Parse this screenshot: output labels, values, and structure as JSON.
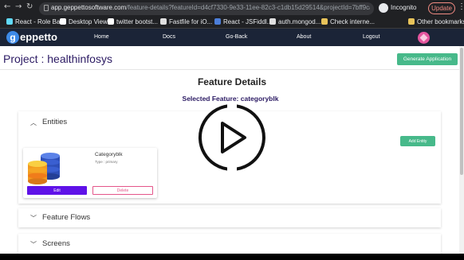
{
  "browser": {
    "url_host": "app.geppettosoftware.com",
    "url_path": "/feature-details?featureId=d4cf7330-9e33-11ee-82c3-c1db15d29514&projectId=7bff9ca0-9a4e-11ee-a...",
    "incognito_label": "Incognito",
    "update_label": "Update",
    "bookmarks": [
      {
        "label": "React - Role Ba...",
        "icon_color": "#61dafb"
      },
      {
        "label": "Desktop View",
        "icon_color": "#ffffff"
      },
      {
        "label": "twitter bootst...",
        "icon_color": "#ffffff"
      },
      {
        "label": "Fastfile for iO...",
        "icon_color": "#e0e0e0"
      },
      {
        "label": "React - JSFiddl...",
        "icon_color": "#4c7ed9"
      },
      {
        "label": "auth.mongod...",
        "icon_color": "#e0e0e0"
      },
      {
        "label": "Check interne...",
        "icon_color": "#e8c35a"
      }
    ],
    "other_bookmarks": "Other bookmarks"
  },
  "navbar": {
    "logo_mark": "g",
    "logo_text": "eppetto",
    "links": [
      "Home",
      "Docs",
      "Go-Back",
      "About",
      "Logout"
    ]
  },
  "project": {
    "title": "Project : healthinfosys",
    "generate_label": "Generate Application"
  },
  "feature": {
    "heading": "Feature Details",
    "selected": "Selected Feature: categoryblk"
  },
  "sections": {
    "entities": "Entities",
    "feature_flows": "Feature Flows",
    "screens": "Screens"
  },
  "add_entity_label": "Add Entity",
  "entity": {
    "name": "Categoryblk",
    "type": "Type : primary",
    "edit_label": "Edit",
    "delete_label": "Delete"
  },
  "colors": {
    "navbar": "#1b2437",
    "accent_green": "#47b98a",
    "edit_purple": "#5f12e8",
    "delete_pink": "#e4558a",
    "title_purple": "#2b1a63"
  },
  "icons": {
    "overlay": "play-circle-icon",
    "entity_image": "database-stack-icon"
  }
}
